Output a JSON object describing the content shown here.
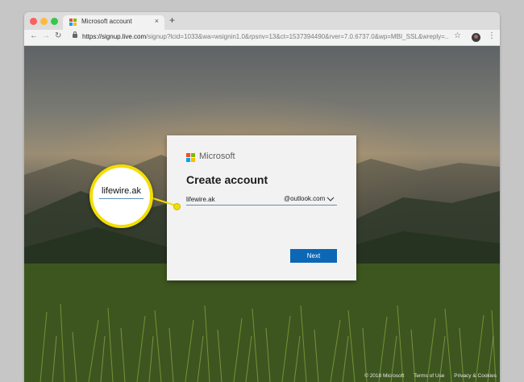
{
  "browser": {
    "tab_title": "Microsoft account",
    "tab_close": "×",
    "new_tab": "+",
    "url_host": "https://signup.live.com",
    "url_path": "/signup?lcid=1033&wa=wsignin1.0&rpsnv=13&ct=1537394490&rver=7.0.6737.0&wp=MBI_SSL&wreply=..."
  },
  "signup": {
    "brand": "Microsoft",
    "heading": "Create account",
    "email_value": "lifewire.ak",
    "domain_value": "@outlook.com",
    "next_label": "Next"
  },
  "callout": {
    "magnified_text": "lifewire.ak",
    "accent_color": "#f2de00"
  },
  "footer": {
    "copyright": "© 2018 Microsoft",
    "terms": "Terms of Use",
    "privacy": "Privacy & Cookies"
  },
  "icons": [
    "back-arrow-icon",
    "forward-arrow-icon",
    "reload-icon",
    "lock-icon",
    "star-icon",
    "profile-avatar",
    "menu-dots-icon",
    "microsoft-logo-icon",
    "chevron-down-icon"
  ],
  "colors": {
    "next_button": "#0c67b5",
    "logo_red": "#f25022",
    "logo_green": "#7fba00",
    "logo_blue": "#00a4ef",
    "logo_yellow": "#ffb900"
  }
}
